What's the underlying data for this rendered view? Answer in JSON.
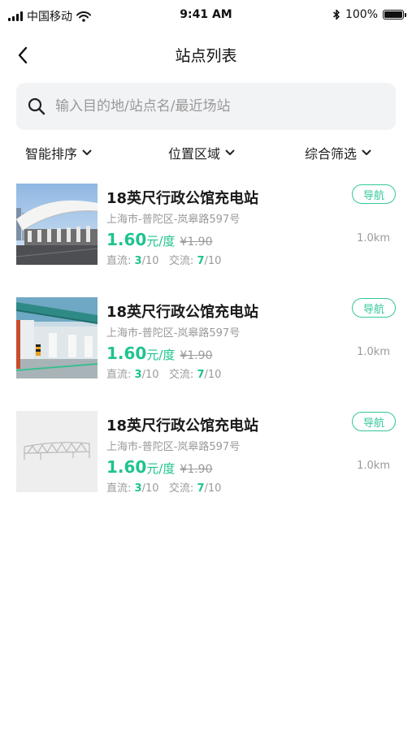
{
  "status_bar": {
    "carrier": "中国移动",
    "time": "9:41 AM",
    "battery_text": "100%",
    "battery_level": 1.0,
    "icons": [
      "signal-icon",
      "wifi-icon",
      "bluetooth-icon",
      "battery-icon"
    ]
  },
  "nav": {
    "title": "站点列表",
    "back_icon": "chevron-left-icon"
  },
  "search": {
    "placeholder": "输入目的地/站点名/最近场站",
    "value": "",
    "icon": "search-icon"
  },
  "filters": [
    {
      "label": "智能排序",
      "icon": "chevron-down-icon"
    },
    {
      "label": "位置区域",
      "icon": "chevron-down-icon"
    },
    {
      "label": "综合筛选",
      "icon": "chevron-down-icon"
    }
  ],
  "colors": {
    "accent": "#1fc38f",
    "muted": "#9a9a9a",
    "search_bg": "#f2f3f5"
  },
  "stations": [
    {
      "name": "18英尺行政公馆充电站",
      "address": "上海市-普陀区-岚皋路597号",
      "price": "1.60",
      "price_unit": "元/度",
      "old_price": "¥1.90",
      "dc_label": "直流:",
      "dc_available": "3",
      "dc_total": "/10",
      "ac_label": "交流:",
      "ac_available": "7",
      "ac_total": "/10",
      "nav_label": "导航",
      "distance": "1.0km",
      "image": "photo-charging-canopy"
    },
    {
      "name": "18英尺行政公馆充电站",
      "address": "上海市-普陀区-岚皋路597号",
      "price": "1.60",
      "price_unit": "元/度",
      "old_price": "¥1.90",
      "dc_label": "直流:",
      "dc_available": "3",
      "dc_total": "/10",
      "ac_label": "交流:",
      "ac_available": "7",
      "ac_total": "/10",
      "nav_label": "导航",
      "distance": "1.0km",
      "image": "photo-charging-station"
    },
    {
      "name": "18英尺行政公馆充电站",
      "address": "上海市-普陀区-岚皋路597号",
      "price": "1.60",
      "price_unit": "元/度",
      "old_price": "¥1.90",
      "dc_label": "直流:",
      "dc_available": "3",
      "dc_total": "/10",
      "ac_label": "交流:",
      "ac_available": "7",
      "ac_total": "/10",
      "nav_label": "导航",
      "distance": "1.0km",
      "image": "placeholder-canopy"
    }
  ]
}
